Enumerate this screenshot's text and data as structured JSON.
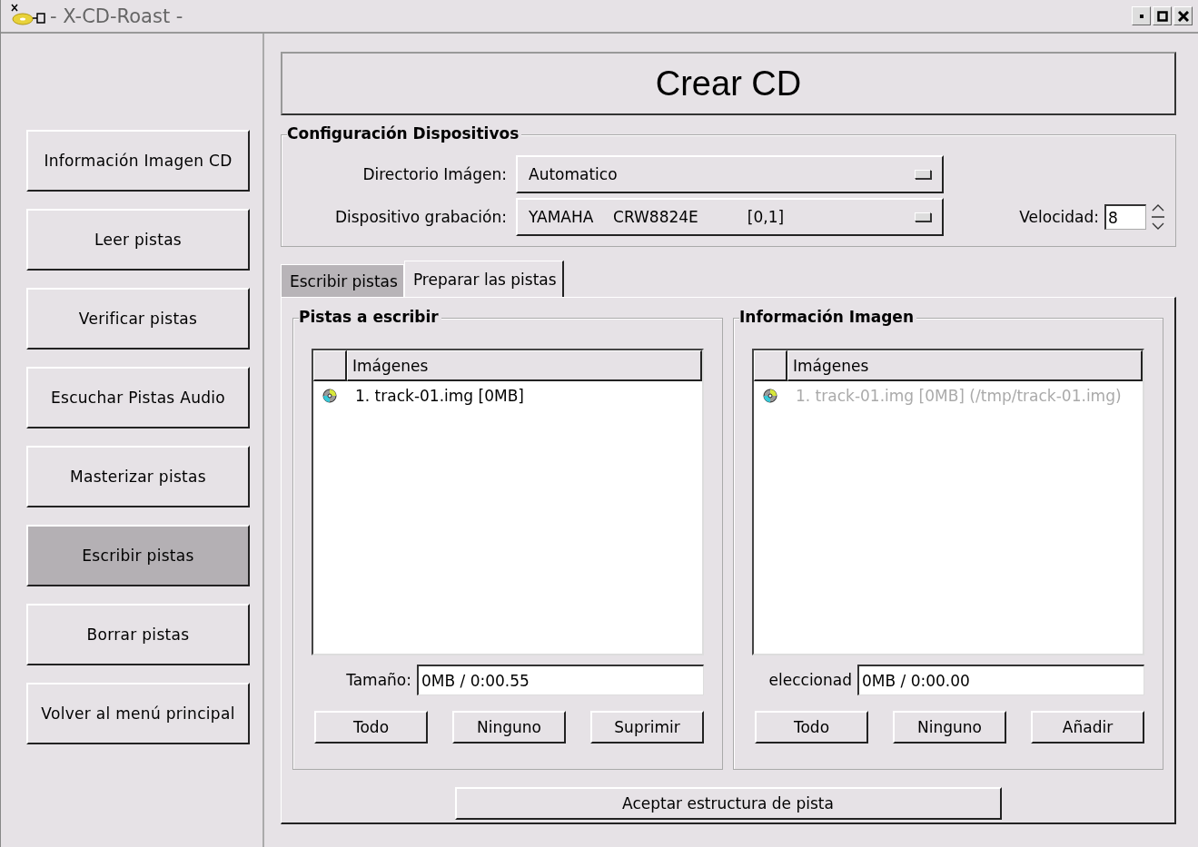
{
  "window": {
    "title": "- X-CD-Roast -"
  },
  "sidebar": {
    "items": [
      {
        "label": "Información Imagen CD",
        "selected": false
      },
      {
        "label": "Leer pistas",
        "selected": false
      },
      {
        "label": "Verificar pistas",
        "selected": false
      },
      {
        "label": "Escuchar Pistas Audio",
        "selected": false
      },
      {
        "label": "Masterizar pistas",
        "selected": false
      },
      {
        "label": "Escribir pistas",
        "selected": true
      },
      {
        "label": "Borrar pistas",
        "selected": false
      },
      {
        "label": "Volver al menú principal",
        "selected": false
      }
    ]
  },
  "header": {
    "title": "Crear CD"
  },
  "device_config": {
    "title": "Configuración Dispositivos",
    "rows": [
      {
        "label": "Directorio Imágen:",
        "value": "Automatico"
      },
      {
        "label": "Dispositivo grabación:",
        "value": "YAMAHA    CRW8824E          [0,1]"
      }
    ],
    "speed": {
      "label": "Velocidad:",
      "value": "8"
    }
  },
  "tabs": [
    {
      "label": "Escribir pistas",
      "selected": false
    },
    {
      "label": "Preparar las pistas",
      "selected": true
    }
  ],
  "panels": [
    {
      "title": "Pistas a escribir",
      "column": "Imágenes",
      "items": [
        {
          "text": "1. track-01.img [0MB]",
          "dimmed": false
        }
      ],
      "field_label": "Tamaño:",
      "field_value": "0MB / 0:00.55",
      "buttons": [
        "Todo",
        "Ninguno",
        "Suprimir"
      ]
    },
    {
      "title": "Información Imagen",
      "column": "Imágenes",
      "items": [
        {
          "text": "1. track-01.img [0MB] (/tmp/track-01.img)",
          "dimmed": true
        }
      ],
      "field_label": "eleccionad",
      "field_value": "0MB / 0:00.00",
      "buttons": [
        "Todo",
        "Ninguno",
        "Añadir"
      ]
    }
  ],
  "accept_button": "Aceptar estructura de pista"
}
